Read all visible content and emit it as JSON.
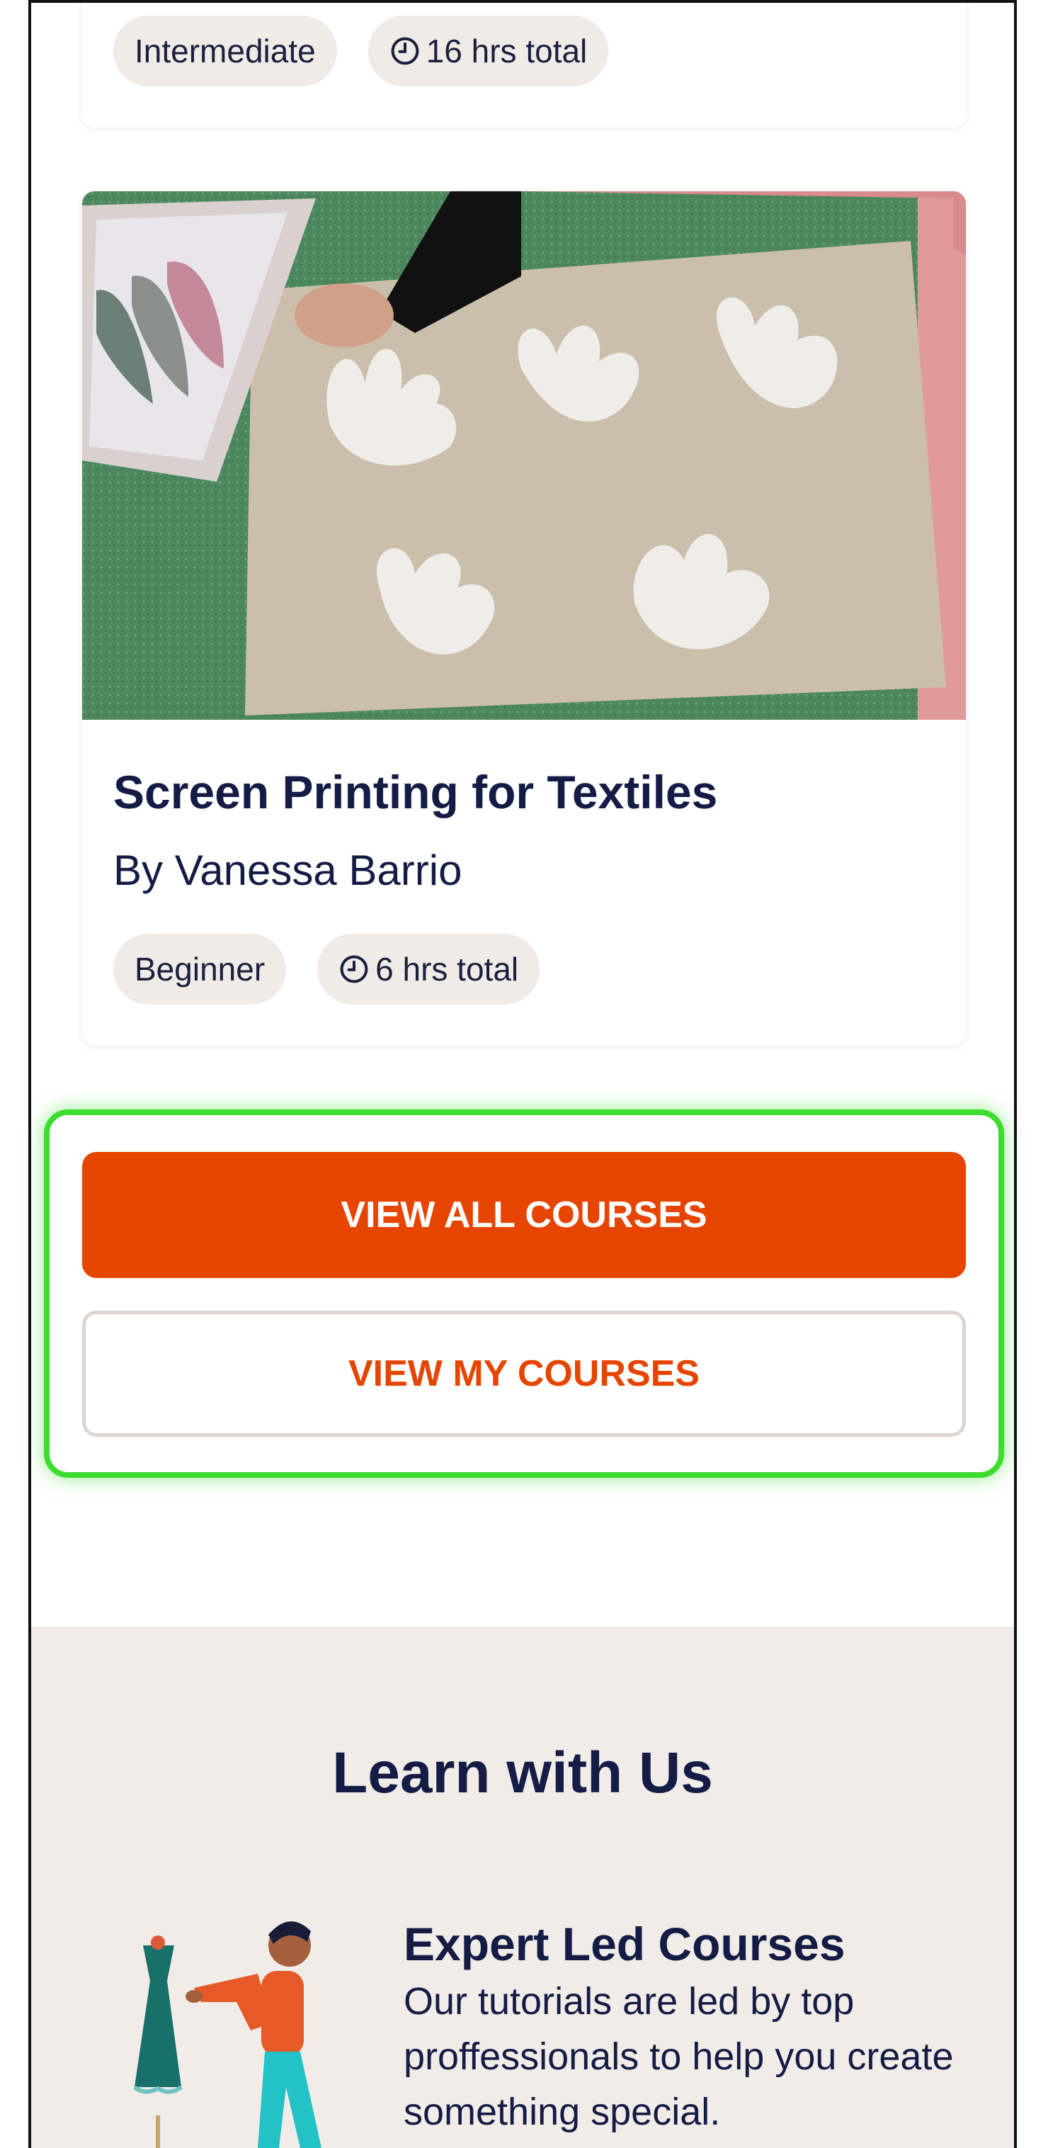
{
  "previous_course": {
    "level": "Intermediate",
    "duration": "16 hrs total"
  },
  "course": {
    "title": "Screen Printing for Textiles",
    "author": "By Vanessa Barrio",
    "level": "Beginner",
    "duration": "6 hrs total",
    "image_icon": "screen-printing-photo"
  },
  "actions": {
    "view_all": "VIEW ALL COURSES",
    "view_mine": "VIEW MY COURSES"
  },
  "learn": {
    "heading": "Learn with Us",
    "feature_title": "Expert Led Courses",
    "feature_text": "Our tutorials are led by top proffessionals to help you create something special.",
    "illustration_icon": "tailor-with-mannequin-icon"
  },
  "colors": {
    "accent": "#e64500",
    "navy": "#141c46",
    "chip_bg": "#f0ebe6",
    "section_bg": "#f1ece7",
    "highlight": "#3ddc2e"
  }
}
